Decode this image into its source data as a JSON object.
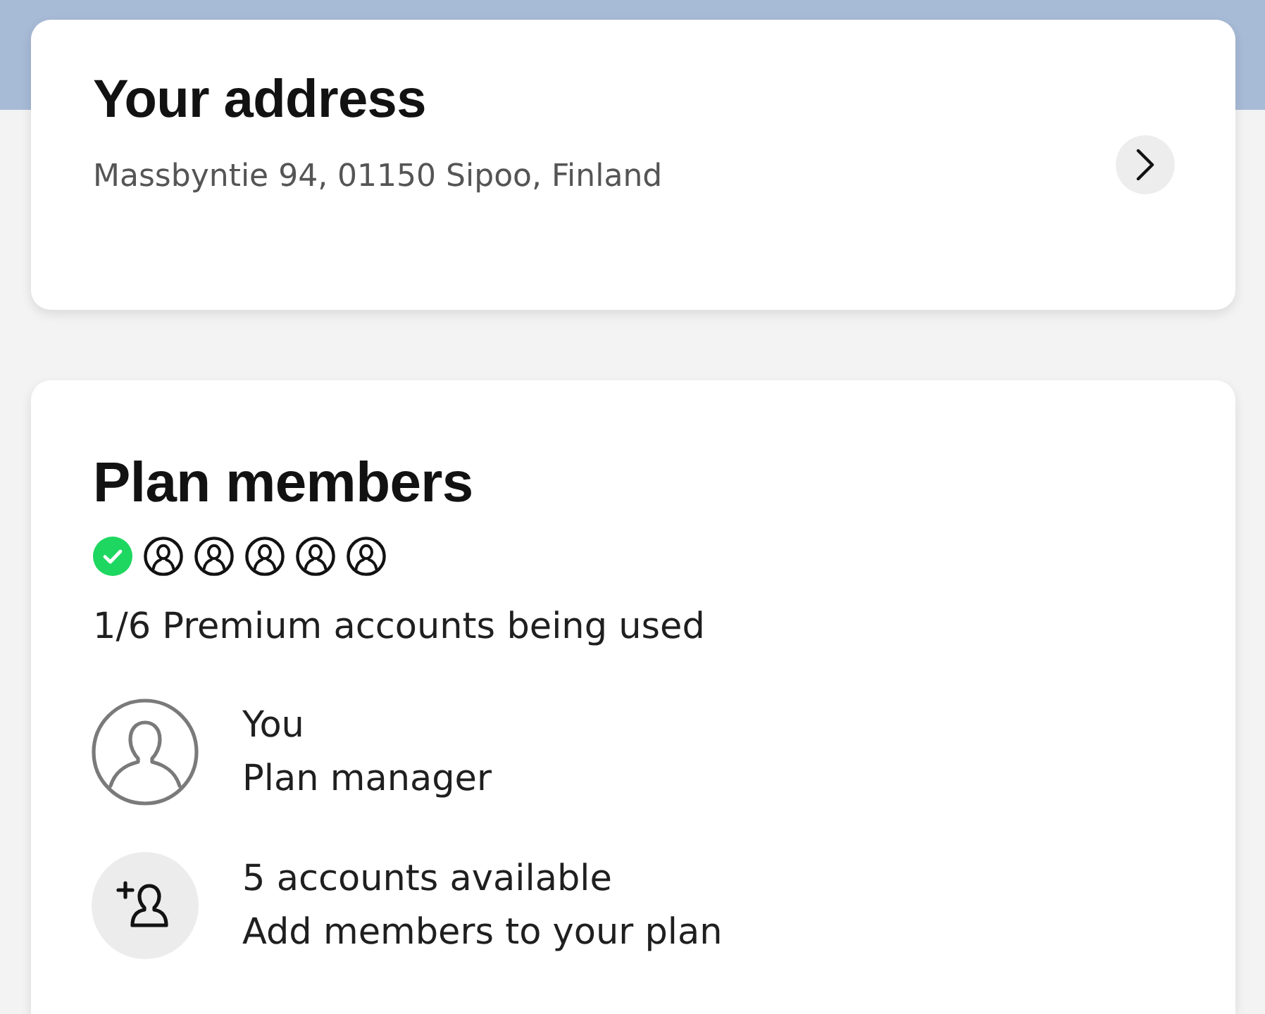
{
  "address_card": {
    "title": "Your address",
    "address": "Massbyntie 94, 01150 Sipoo, Finland"
  },
  "plan_members": {
    "title": "Plan members",
    "slots": [
      {
        "used": true
      },
      {
        "used": false
      },
      {
        "used": false
      },
      {
        "used": false
      },
      {
        "used": false
      },
      {
        "used": false
      }
    ],
    "usage": "1/6 Premium accounts being used",
    "members": [
      {
        "kind": "member",
        "primary": "You",
        "secondary": "Plan manager"
      },
      {
        "kind": "add",
        "primary": "5 accounts available",
        "secondary": "Add members to your plan"
      }
    ]
  }
}
